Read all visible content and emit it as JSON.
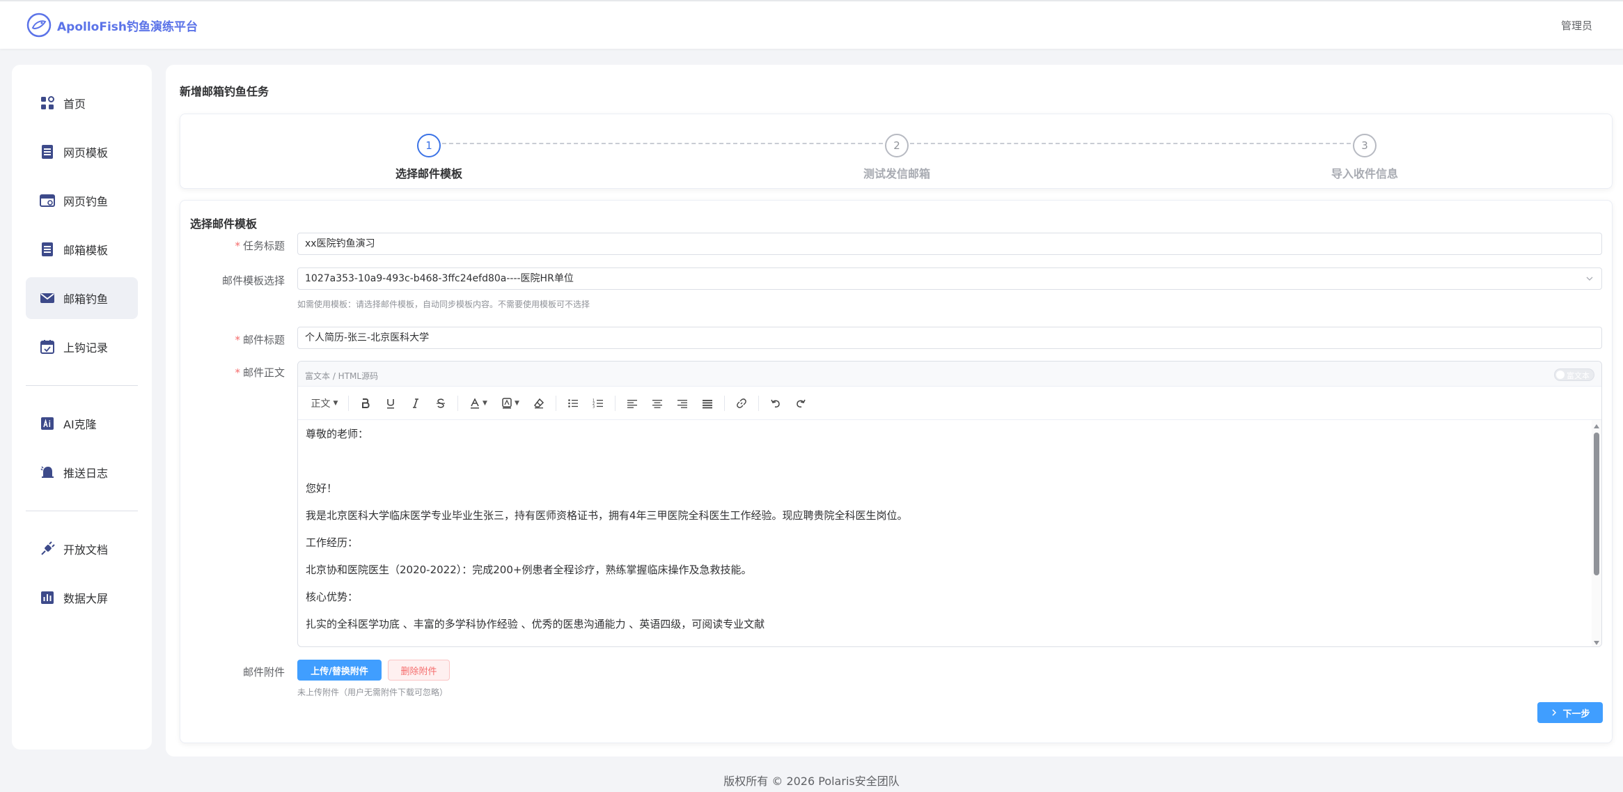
{
  "header": {
    "brand": "ApolloFish钓鱼演练平台",
    "user": "管理员",
    "logo_icon": "fish-logo-icon"
  },
  "sidebar": {
    "items": [
      {
        "label": "首页",
        "icon": "grid-icon"
      },
      {
        "label": "网页模板",
        "icon": "document-icon"
      },
      {
        "label": "网页钓鱼",
        "icon": "browser-icon"
      },
      {
        "label": "邮箱模板",
        "icon": "document-icon"
      },
      {
        "label": "邮箱钓鱼",
        "icon": "mail-icon",
        "active": true
      },
      {
        "label": "上钩记录",
        "icon": "calendar-icon"
      },
      {
        "label": "AI克隆",
        "icon": "ai-icon"
      },
      {
        "label": "推送日志",
        "icon": "bell-icon"
      },
      {
        "label": "开放文档",
        "icon": "plugin-icon"
      },
      {
        "label": "数据大屏",
        "icon": "chart-icon"
      }
    ]
  },
  "page": {
    "title": "新增邮箱钓鱼任务"
  },
  "steps": [
    {
      "num": "1",
      "label": "选择邮件模板",
      "active": true
    },
    {
      "num": "2",
      "label": "测试发信邮箱",
      "active": false
    },
    {
      "num": "3",
      "label": "导入收件信息",
      "active": false
    }
  ],
  "form": {
    "section_title": "选择邮件模板",
    "task_title_label": "任务标题",
    "task_title_value": "xx医院钓鱼演习",
    "template_label": "邮件模板选择",
    "template_value": "1027a353-10a9-493c-b468-3ffc24efd80a----医院HR单位",
    "template_hint": "如需使用模板：请选择邮件模板，自动同步模板内容。不需要使用模板可不选择",
    "mail_subject_label": "邮件标题",
    "mail_subject_value": "个人简历-张三-北京医科大学",
    "mail_body_label": "邮件正文",
    "attachment_label": "邮件附件",
    "upload_button": "上传/替换附件",
    "delete_button": "删除附件",
    "attachment_hint": "未上传附件（用户无需附件下载可忽略）",
    "next_button": "下一步"
  },
  "editor": {
    "mode_label": "富文本 / HTML源码",
    "toggle_label": "富文本",
    "format_select": "正文",
    "toolbar_icons": [
      "bold-icon",
      "underline-icon",
      "italic-icon",
      "strikethrough-icon",
      "font-color-icon",
      "background-color-icon",
      "eraser-icon",
      "bullet-list-icon",
      "numbered-list-icon",
      "align-left-icon",
      "align-center-icon",
      "align-right-icon",
      "align-justify-icon",
      "link-icon",
      "undo-icon",
      "redo-icon"
    ],
    "lines": [
      "尊敬的老师：",
      "",
      "您好！",
      "我是北京医科大学临床医学专业毕业生张三，持有医师资格证书，拥有4年三甲医院全科医生工作经验。现应聘贵院全科医生岗位。",
      "工作经历：",
      "北京协和医院医生（2020-2022）：完成200+例患者全程诊疗，熟练掌握临床操作及急救技能。",
      "核心优势：",
      "扎实的全科医学功底 、丰富的多学科协作经验 、优秀的医患沟通能力 、英语四级，可阅读专业文献"
    ]
  },
  "footer": {
    "copyright": "版权所有 © 2026 Polaris安全团队"
  },
  "colors": {
    "brand": "#5b73e8",
    "primary": "#409eff",
    "danger": "#f56c6c",
    "step_active": "#3b73e6"
  }
}
